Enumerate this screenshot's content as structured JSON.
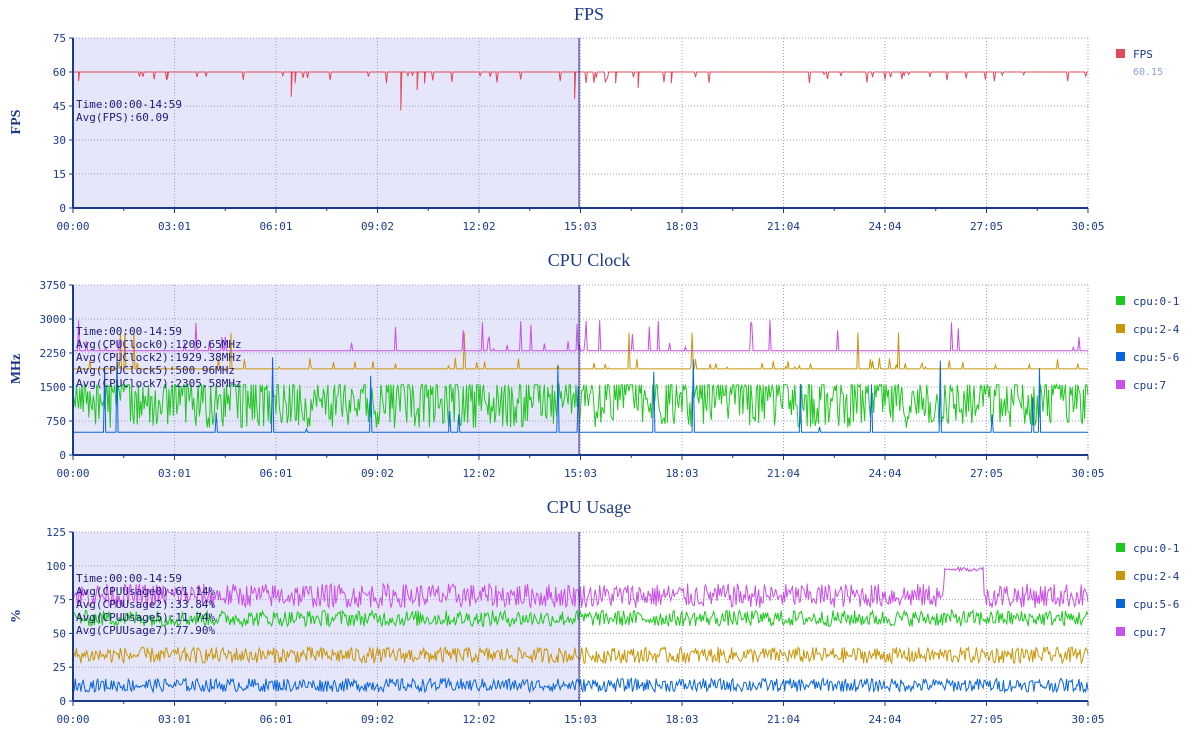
{
  "chart_data": [
    {
      "type": "line",
      "title": "FPS",
      "ylabel": "FPS",
      "ylim": [
        0,
        75
      ],
      "yticks": [
        "0",
        "15",
        "30",
        "45",
        "60",
        "75"
      ],
      "xticks": [
        "00:00",
        "03:01",
        "06:01",
        "09:02",
        "12:02",
        "15:03",
        "18:03",
        "21:04",
        "24:04",
        "27:05",
        "30:05"
      ],
      "xlim_seconds": [
        0,
        1805
      ],
      "selection": {
        "start": "00:00",
        "end": "14:59"
      },
      "annotation": [
        "Time:00:00-14:59",
        "Avg(FPS):60.09"
      ],
      "grid": true,
      "legend_position": "right",
      "series": [
        {
          "name": "FPS",
          "legend_value": "60.15",
          "color": "#e04a5a",
          "base": 60,
          "min": 42,
          "max": 60,
          "dips": [
            [
              10,
              56
            ],
            [
              168,
              57
            ],
            [
              388,
              49
            ],
            [
              395,
              55
            ],
            [
              583,
              43
            ],
            [
              612,
              52
            ],
            [
              625,
              55
            ],
            [
              892,
              48
            ],
            [
              965,
              55
            ],
            [
              1005,
              53
            ],
            [
              1064,
              55
            ]
          ]
        }
      ]
    },
    {
      "type": "line",
      "title": "CPU Clock",
      "ylabel": "MHz",
      "ylim": [
        0,
        3750
      ],
      "yticks": [
        "0",
        "750",
        "1500",
        "2250",
        "3000",
        "3750"
      ],
      "xticks": [
        "00:00",
        "03:01",
        "06:01",
        "09:02",
        "12:02",
        "15:03",
        "18:03",
        "21:04",
        "24:04",
        "27:05",
        "30:05"
      ],
      "xlim_seconds": [
        0,
        1805
      ],
      "selection": {
        "start": "00:00",
        "end": "14:59"
      },
      "annotation": [
        "Time:00:00-14:59",
        "Avg(CPUClock0):1200.65MHz",
        "Avg(CPUClock2):1929.38MHz",
        "Avg(CPUClock5):500.96MHz",
        "Avg(CPUClock7):2305.58MHz"
      ],
      "grid": true,
      "legend_position": "right",
      "series": [
        {
          "name": "cpu:0-1",
          "color": "#1ec81e",
          "avg": 1200.65,
          "min": 500,
          "max": 1550
        },
        {
          "name": "cpu:2-4",
          "color": "#c8960a",
          "avg": 1929.38,
          "min": 1900,
          "max": 2700
        },
        {
          "name": "cpu:5-6",
          "color": "#0a64dc",
          "avg": 500.96,
          "min": 500,
          "max": 2200
        },
        {
          "name": "cpu:7",
          "color": "#c850e6",
          "avg": 2305.58,
          "min": 2300,
          "max": 3000
        }
      ]
    },
    {
      "type": "line",
      "title": "CPU Usage",
      "ylabel": "%",
      "ylim": [
        0,
        125
      ],
      "yticks": [
        "0",
        "25",
        "50",
        "75",
        "100",
        "125"
      ],
      "xticks": [
        "00:00",
        "03:01",
        "06:01",
        "09:02",
        "12:02",
        "15:03",
        "18:03",
        "21:04",
        "24:04",
        "27:05",
        "30:05"
      ],
      "xlim_seconds": [
        0,
        1805
      ],
      "selection": {
        "start": "00:00",
        "end": "14:59"
      },
      "annotation": [
        "Time:00:00-14:59",
        "Avg(CPUUsage0):61.14%",
        "Avg(CPUUsage2):33.84%",
        "Avg(CPUUsage5):11.74%",
        "Avg(CPUUsage7):77.90%"
      ],
      "grid": true,
      "legend_position": "right",
      "series": [
        {
          "name": "cpu:0-1",
          "color": "#1ec81e",
          "avg": 61.14,
          "spread": 6
        },
        {
          "name": "cpu:2-4",
          "color": "#c8960a",
          "avg": 33.84,
          "spread": 6
        },
        {
          "name": "cpu:5-6",
          "color": "#0a64dc",
          "avg": 11.74,
          "spread": 5
        },
        {
          "name": "cpu:7",
          "color": "#c850e6",
          "avg": 77.9,
          "spread": 9
        }
      ]
    }
  ],
  "colors": {
    "axis": "#1c3a8a",
    "grid": "#9aa0c8",
    "selection_fill": "#e6e6fa",
    "selection_line": "#3a3a9a"
  }
}
